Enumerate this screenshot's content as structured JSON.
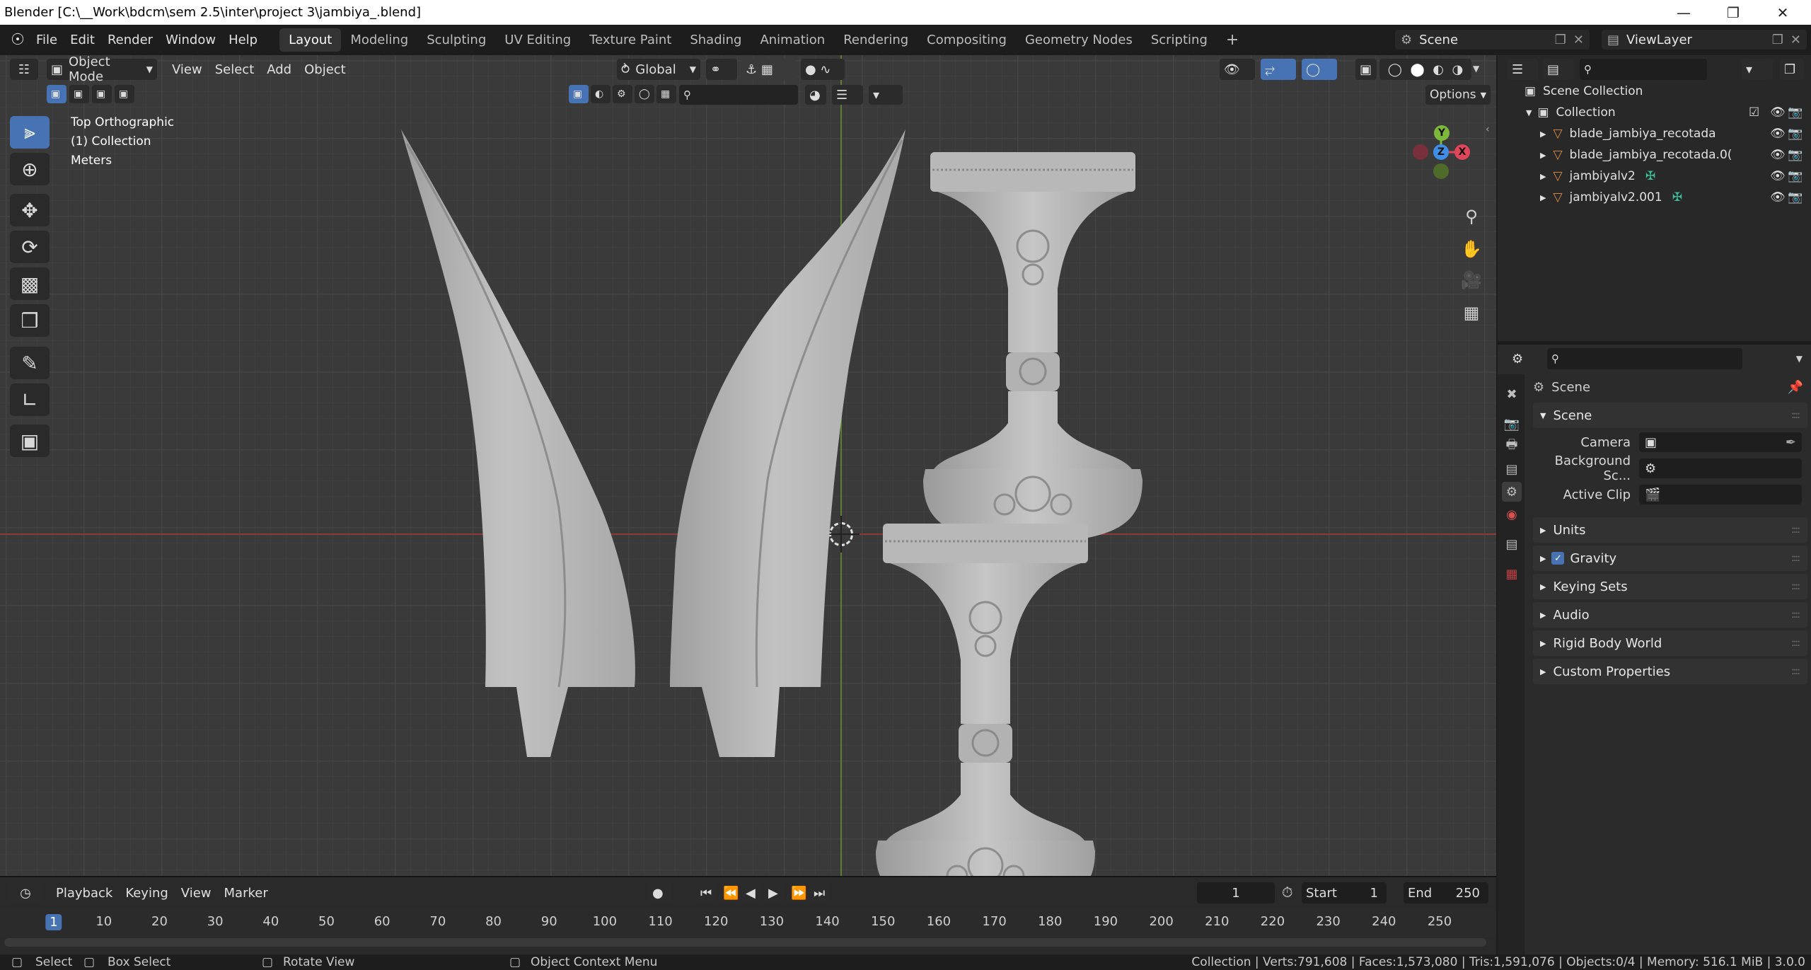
{
  "window": {
    "title": "Blender [C:\\__Work\\bdcm\\sem 2.5\\inter\\project 3\\jambiya_.blend]"
  },
  "menu": [
    "File",
    "Edit",
    "Render",
    "Window",
    "Help"
  ],
  "workspaces": {
    "tabs": [
      "Layout",
      "Modeling",
      "Sculpting",
      "UV Editing",
      "Texture Paint",
      "Shading",
      "Animation",
      "Rendering",
      "Compositing",
      "Geometry Nodes",
      "Scripting"
    ],
    "active": "Layout"
  },
  "scene_selector": {
    "value": "Scene"
  },
  "viewlayer_selector": {
    "value": "ViewLayer"
  },
  "viewport_header": {
    "mode": "Object Mode",
    "menus": [
      "View",
      "Select",
      "Add",
      "Object"
    ],
    "transform_orientation": "Global",
    "options_label": "Options"
  },
  "viewport_overlay": {
    "view_name": "Top Orthographic",
    "collection": "(1) Collection",
    "units": "Meters"
  },
  "gizmo": {
    "x": "X",
    "y": "Y",
    "z": "Z"
  },
  "outliner": {
    "root": "Scene Collection",
    "collection": "Collection",
    "objects": [
      {
        "name": "blade_jambiya_recotada",
        "has_mesh_data": false
      },
      {
        "name": "blade_jambiya_recotada.0(",
        "has_mesh_data": false
      },
      {
        "name": "jambiyalv2",
        "has_mesh_data": true
      },
      {
        "name": "jambiyalv2.001",
        "has_mesh_data": true
      }
    ]
  },
  "properties": {
    "context_title": "Scene",
    "panels": {
      "scene": "Scene",
      "camera_label": "Camera",
      "background_label": "Background Sc...",
      "active_clip_label": "Active Clip",
      "units": "Units",
      "gravity": "Gravity",
      "gravity_enabled": true,
      "keying_sets": "Keying Sets",
      "audio": "Audio",
      "rigid_body_world": "Rigid Body World",
      "custom_properties": "Custom Properties"
    }
  },
  "timeline": {
    "menus": [
      "Playback",
      "Keying",
      "View",
      "Marker"
    ],
    "current_frame": "1",
    "start_label": "Start",
    "start": "1",
    "end_label": "End",
    "end": "250",
    "ruler": [
      "1",
      "10",
      "20",
      "30",
      "40",
      "50",
      "60",
      "70",
      "80",
      "90",
      "100",
      "110",
      "120",
      "130",
      "140",
      "150",
      "160",
      "170",
      "180",
      "190",
      "200",
      "210",
      "220",
      "230",
      "240",
      "250"
    ]
  },
  "statusbar": {
    "select": "Select",
    "box_select": "Box Select",
    "rotate_view": "Rotate View",
    "context_menu": "Object Context Menu",
    "stats": "Collection | Verts:791,608 | Faces:1,573,080 | Tris:1,591,076 | Objects:0/4 | Memory: 516.1 MiB | 3.0.0"
  },
  "colors": {
    "accent": "#4772b3",
    "x_axis": "#e0455a",
    "y_axis": "#7db83a",
    "z_axis": "#3d8ee6",
    "mesh": "#bdbdbd",
    "object_icon": "#e08d3c"
  }
}
